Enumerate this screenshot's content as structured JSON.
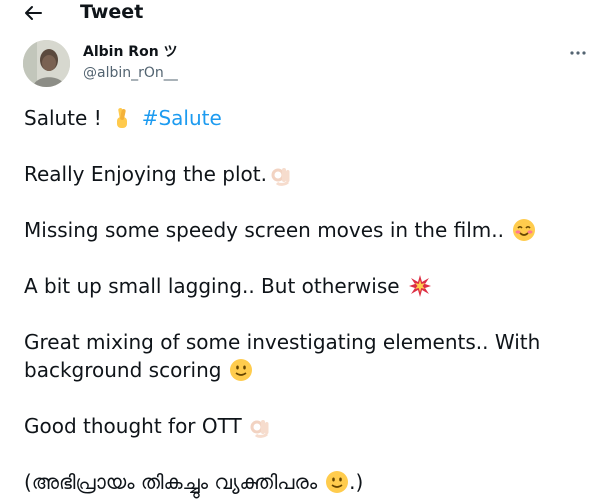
{
  "header": {
    "title": "Tweet"
  },
  "author": {
    "name": "Albin Ron ツ",
    "handle": "@albin_rOn__"
  },
  "tweet": {
    "line1_text": "Salute !",
    "hashtag": "#Salute",
    "line2": "Really Enjoying the plot.",
    "line3": "Missing some speedy screen moves in the film..",
    "line4": "A bit up small lagging.. But otherwise",
    "line5a": "Great mixing of some investigating elements.. With",
    "line5b": "background scoring",
    "line6": "Good thought for OTT",
    "line7_open": "(അഭിപ്രായം തികച്ചും വ്യക്തിപരം",
    "line7_close": ".)"
  },
  "icons": {
    "back": "back-arrow-icon",
    "more": "more-options-icon",
    "fingers_crossed": "fingers-crossed-emoji",
    "ok_hand": "ok-hand-emoji",
    "smiling_face": "smiling-face-emoji",
    "collision": "collision-emoji",
    "slight_smile": "slightly-smiling-face-emoji"
  },
  "colors": {
    "text": "#0f1419",
    "secondary": "#536471",
    "link": "#1d9bf0"
  }
}
